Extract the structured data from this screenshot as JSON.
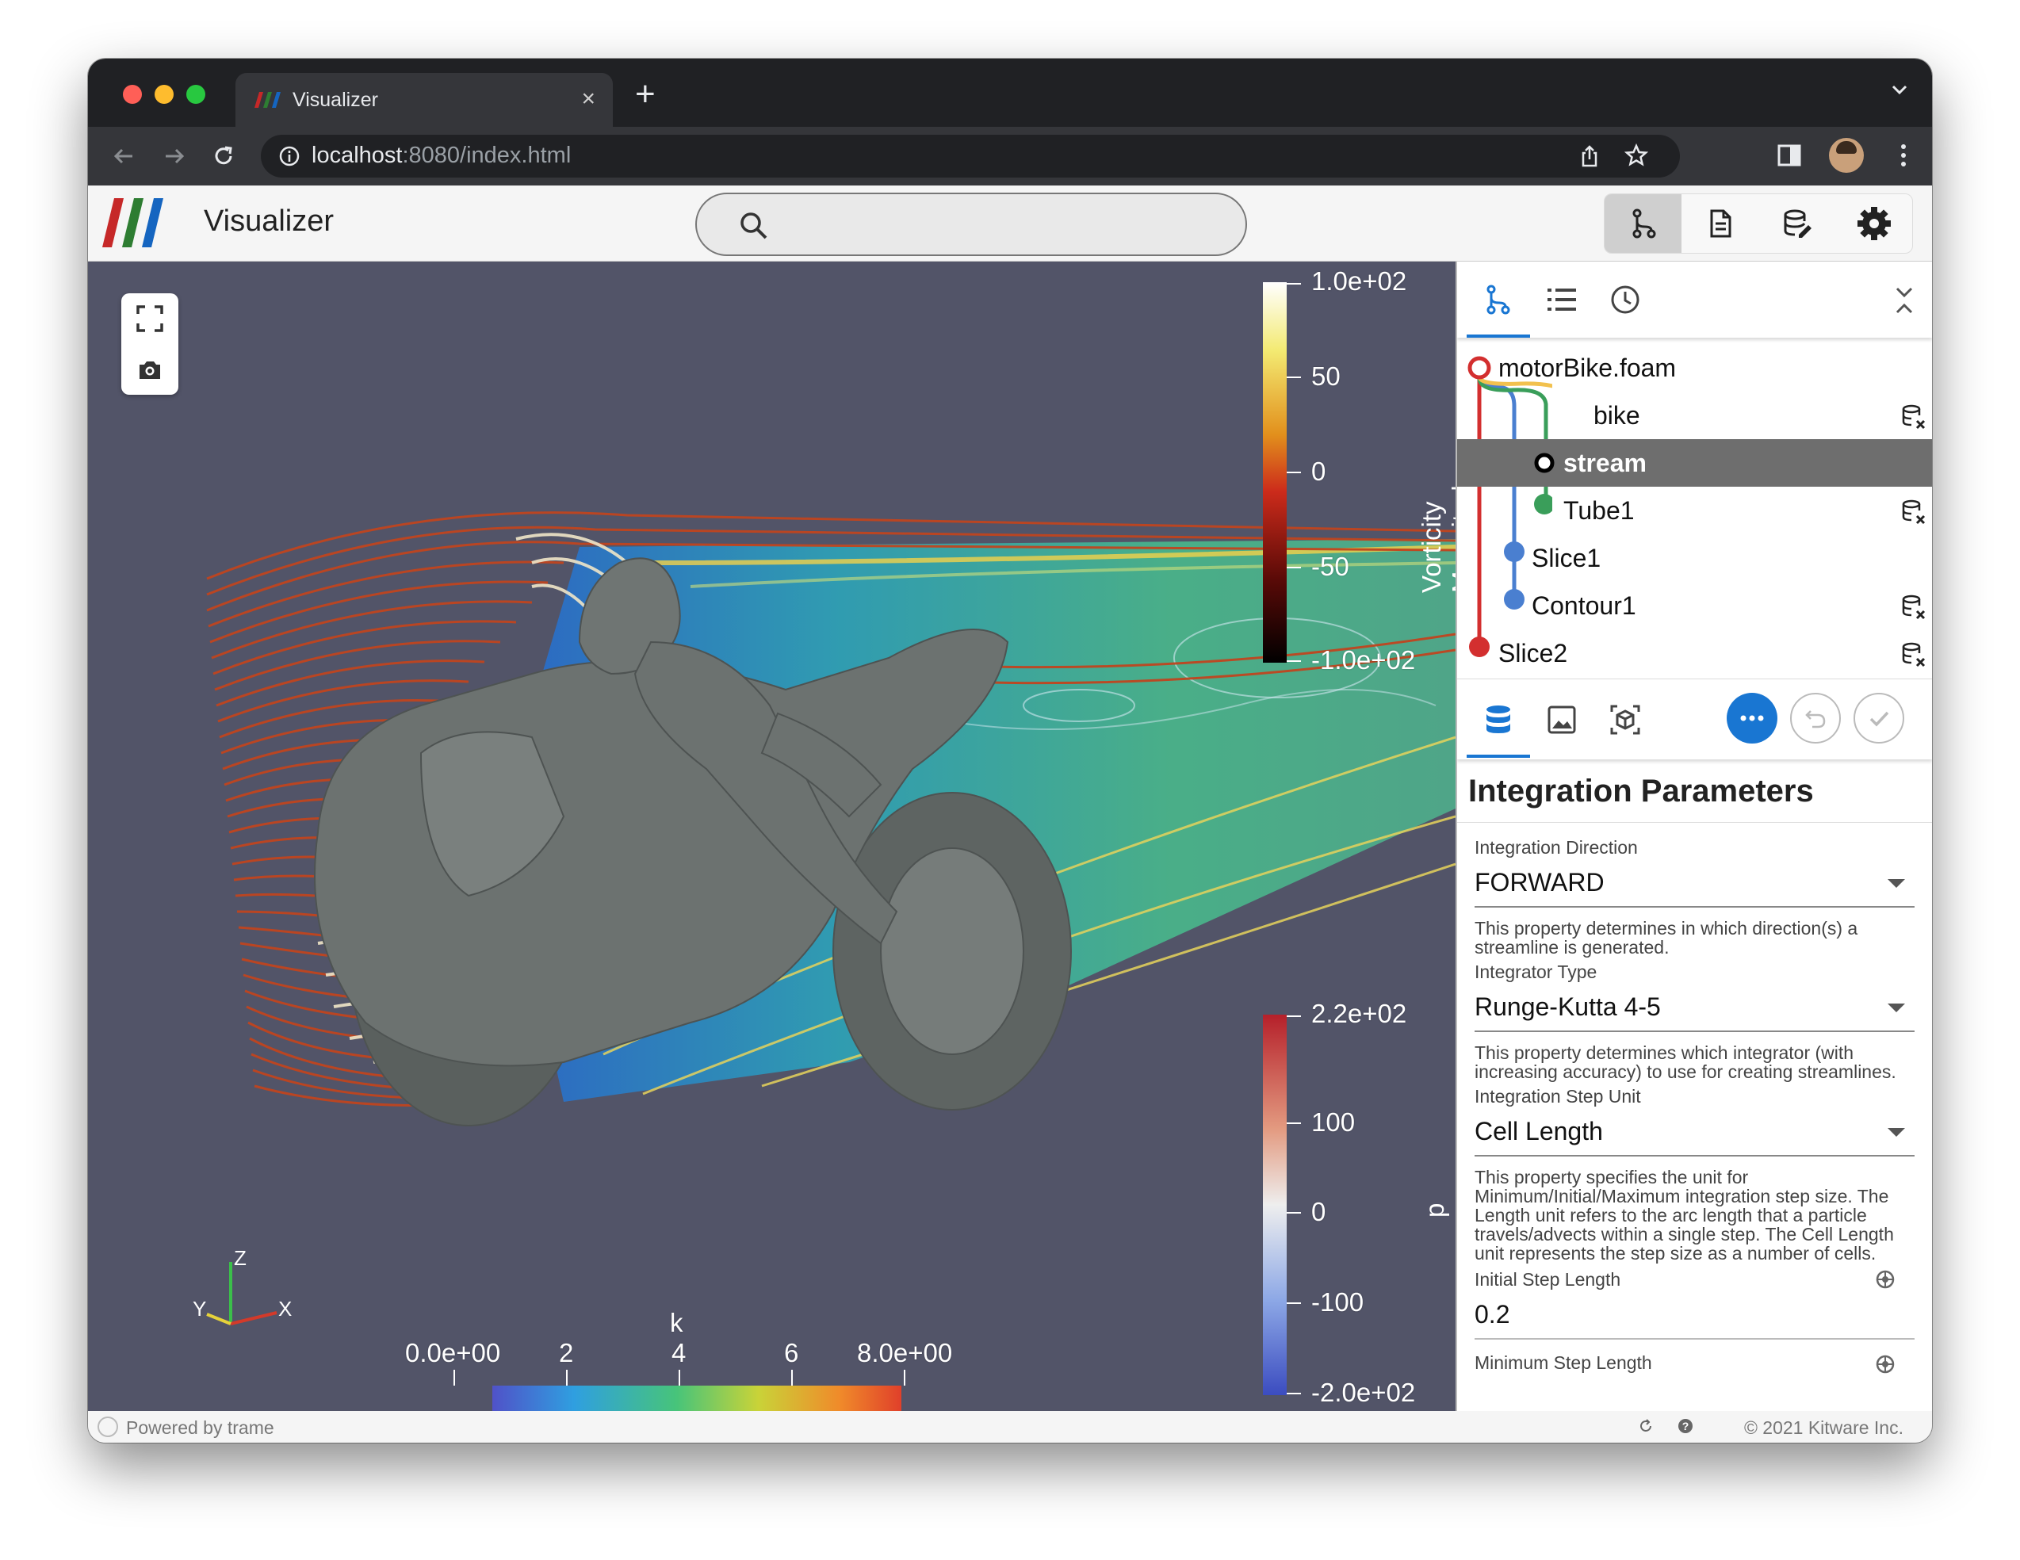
{
  "browser": {
    "tab_title": "Visualizer",
    "url_host": "localhost",
    "url_rest": ":8080/index.html"
  },
  "app": {
    "title": "Visualizer",
    "search_placeholder": ""
  },
  "colorbars": {
    "vorticity": {
      "title": "Vorticity Magnitude",
      "labels": [
        "1.0e+02",
        "50",
        "0",
        "-50",
        "-1.0e+02"
      ]
    },
    "p": {
      "title": "p",
      "labels": [
        "2.2e+02",
        "100",
        "0",
        "-100",
        "-2.0e+02"
      ]
    },
    "k": {
      "title": "k",
      "labels": [
        "0.0e+00",
        "2",
        "4",
        "6",
        "8.0e+00"
      ]
    }
  },
  "pipeline": [
    {
      "label": "motorBike.foam",
      "color": "#d32f2f",
      "hollow": true
    },
    {
      "label": "bike",
      "color": "#f2c14e"
    },
    {
      "label": "stream",
      "color": "#000000",
      "hollow": true,
      "selected": true
    },
    {
      "label": "Tube1",
      "color": "#3a9e5a"
    },
    {
      "label": "Slice1",
      "color": "#4a7fd0"
    },
    {
      "label": "Contour1",
      "color": "#4a7fd0"
    },
    {
      "label": "Slice2",
      "color": "#d32f2f"
    }
  ],
  "section_title": "Integration Parameters",
  "properties": {
    "direction": {
      "label": "Integration Direction",
      "value": "FORWARD",
      "help": "This property determines in which direction(s) a streamline is generated."
    },
    "integrator": {
      "label": "Integrator Type",
      "value": "Runge-Kutta 4-5",
      "help": "This property determines which integrator (with increasing accuracy) to use for creating streamlines."
    },
    "step_unit": {
      "label": "Integration Step Unit",
      "value": "Cell Length",
      "help": "This property specifies the unit for Minimum/Initial/Maximum integration step size. The Length unit refers to the arc length that a particle travels/advects within a single step. The Cell Length unit represents the step size as a number of cells."
    },
    "initial_step": {
      "label": "Initial Step Length",
      "value": "0.2"
    },
    "min_step": {
      "label": "Minimum Step Length"
    }
  },
  "footer": {
    "powered": "Powered by trame",
    "copyright": "© 2021 Kitware Inc."
  },
  "colors": {
    "accent": "#1976d2",
    "viewport_bg": "#525468"
  }
}
